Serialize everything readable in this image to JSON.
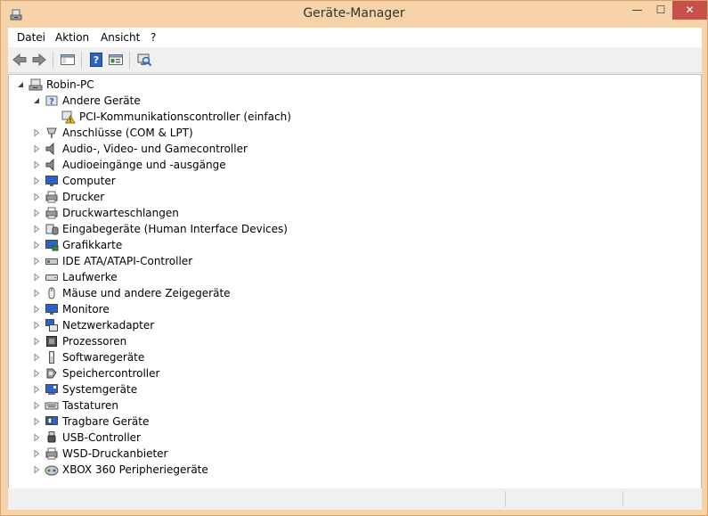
{
  "window": {
    "title": "Geräte-Manager",
    "minimize_glyph": "—",
    "maximize_glyph": "☐",
    "close_glyph": "✕"
  },
  "menu": {
    "items": [
      "Datei",
      "Aktion",
      "Ansicht",
      "?"
    ]
  },
  "toolbar": {
    "icons": [
      "back-arrow-icon",
      "forward-arrow-icon",
      "console-tree-icon",
      "help-icon",
      "properties-icon",
      "scan-hardware-icon"
    ]
  },
  "tree": {
    "root": {
      "label": "Robin-PC",
      "icon": "computer-icon"
    },
    "groups": [
      {
        "label": "Andere Geräte",
        "icon": "unknown-device-icon",
        "expanded": true,
        "children": [
          {
            "label": "PCI-Kommunikationscontroller (einfach)",
            "icon": "warning-device-icon"
          }
        ]
      },
      {
        "label": "Anschlüsse (COM & LPT)",
        "icon": "port-icon"
      },
      {
        "label": "Audio-, Video- und Gamecontroller",
        "icon": "speaker-icon"
      },
      {
        "label": "Audioeingänge und -ausgänge",
        "icon": "speaker-icon"
      },
      {
        "label": "Computer",
        "icon": "monitor-icon"
      },
      {
        "label": "Drucker",
        "icon": "printer-icon"
      },
      {
        "label": "Druckwarteschlangen",
        "icon": "printer-icon"
      },
      {
        "label": "Eingabegeräte (Human Interface Devices)",
        "icon": "hid-icon"
      },
      {
        "label": "Grafikkarte",
        "icon": "display-adapter-icon"
      },
      {
        "label": "IDE ATA/ATAPI-Controller",
        "icon": "ide-controller-icon"
      },
      {
        "label": "Laufwerke",
        "icon": "disk-drive-icon"
      },
      {
        "label": "Mäuse und andere Zeigegeräte",
        "icon": "mouse-icon"
      },
      {
        "label": "Monitore",
        "icon": "monitor-icon"
      },
      {
        "label": "Netzwerkadapter",
        "icon": "network-icon"
      },
      {
        "label": "Prozessoren",
        "icon": "processor-icon"
      },
      {
        "label": "Softwaregeräte",
        "icon": "software-device-icon"
      },
      {
        "label": "Speichercontroller",
        "icon": "storage-controller-icon"
      },
      {
        "label": "Systemgeräte",
        "icon": "system-device-icon"
      },
      {
        "label": "Tastaturen",
        "icon": "keyboard-icon"
      },
      {
        "label": "Tragbare Geräte",
        "icon": "portable-device-icon"
      },
      {
        "label": "USB-Controller",
        "icon": "usb-icon"
      },
      {
        "label": "WSD-Druckanbieter",
        "icon": "printer-icon"
      },
      {
        "label": "XBOX 360 Peripheriegeräte",
        "icon": "gamepad-icon"
      }
    ]
  },
  "colors": {
    "frame": "#f6d3a8",
    "close": "#c7504a",
    "warning": "#f2c12e"
  }
}
